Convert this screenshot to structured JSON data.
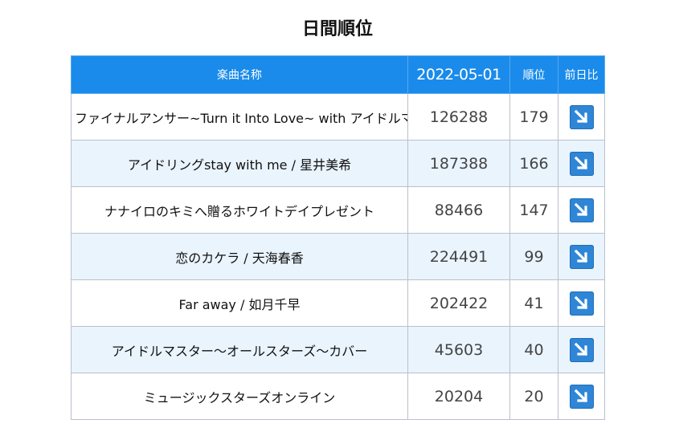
{
  "page_title": "日間順位",
  "table": {
    "headers": {
      "song": "楽曲名称",
      "date": "2022-05-01",
      "rank": "順位",
      "trend": "前日比"
    },
    "rows": [
      {
        "song": "ファイナルアンサー~Turn it Into Love~ with アイドルマスター",
        "plays": "126288",
        "rank": "179",
        "trend_icon": "arrow-down-right-icon"
      },
      {
        "song": "アイドリングstay with me / 星井美希",
        "plays": "187388",
        "rank": "166",
        "trend_icon": "arrow-down-right-icon"
      },
      {
        "song": "ナナイロのキミへ贈るホワイトデイプレゼント",
        "plays": "88466",
        "rank": "147",
        "trend_icon": "arrow-down-right-icon"
      },
      {
        "song": "恋のカケラ / 天海春香",
        "plays": "224491",
        "rank": "99",
        "trend_icon": "arrow-down-right-icon"
      },
      {
        "song": "Far away / 如月千早",
        "plays": "202422",
        "rank": "41",
        "trend_icon": "arrow-down-right-icon"
      },
      {
        "song": "アイドルマスター～オールスターズ～カバー",
        "plays": "45603",
        "rank": "40",
        "trend_icon": "arrow-down-right-icon"
      },
      {
        "song": "ミュージックスターズオンライン",
        "plays": "20204",
        "rank": "20",
        "trend_icon": "arrow-down-right-icon"
      }
    ]
  },
  "colors": {
    "header_bg": "#1a8bea",
    "alt_row_bg": "#eaf4fd",
    "arrow_bg": "#2f86d6"
  }
}
